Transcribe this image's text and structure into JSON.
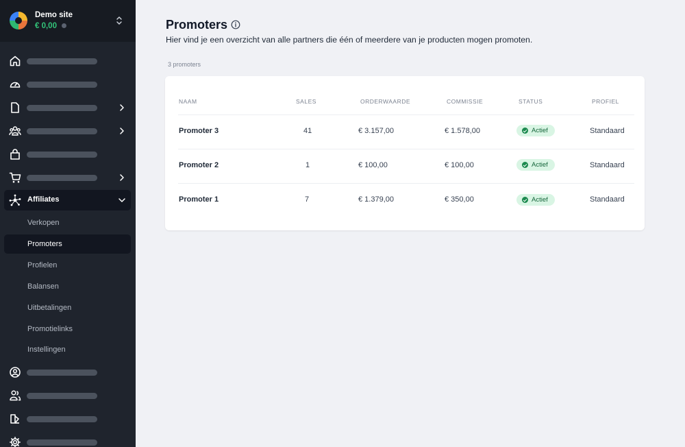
{
  "site": {
    "name": "Demo site",
    "balance": "€ 0,00"
  },
  "nav": {
    "affiliates_label": "Affiliates",
    "sub_items": [
      {
        "label": "Verkopen"
      },
      {
        "label": "Promoters"
      },
      {
        "label": "Profielen"
      },
      {
        "label": "Balansen"
      },
      {
        "label": "Uitbetalingen"
      },
      {
        "label": "Promotielinks"
      },
      {
        "label": "Instellingen"
      }
    ],
    "active_sub_item": "Promoters"
  },
  "page": {
    "title": "Promoters",
    "subtitle": "Hier vind je een overzicht van alle partners die één of meerdere van je producten mogen promoten.",
    "count": "3 promoters"
  },
  "table": {
    "headers": {
      "name": "NAAM",
      "sales": "SALES",
      "order_value": "ORDERWAARDE",
      "commission": "COMMISSIE",
      "status": "STATUS",
      "profile": "PROFIEL"
    },
    "rows": [
      {
        "name": "Promoter 3",
        "sales": "41",
        "order_value": "€ 3.157,00",
        "commission": "€ 1.578,00",
        "status": "Actief",
        "profile": "Standaard"
      },
      {
        "name": "Promoter 2",
        "sales": "1",
        "order_value": "€ 100,00",
        "commission": "€ 100,00",
        "status": "Actief",
        "profile": "Standaard"
      },
      {
        "name": "Promoter 1",
        "sales": "7",
        "order_value": "€ 1.379,00",
        "commission": "€ 350,00",
        "status": "Actief",
        "profile": "Standaard"
      }
    ]
  },
  "colors": {
    "sidebar": "#1f242d",
    "accent_green": "#33c47a",
    "badge_bg": "#d9f5e4"
  }
}
